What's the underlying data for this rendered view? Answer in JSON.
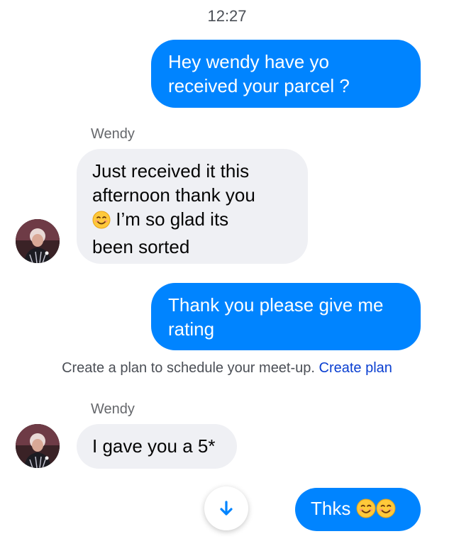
{
  "thread": {
    "timestamp": "12:27",
    "contact_name": "Wendy"
  },
  "messages": [
    {
      "sender": "me",
      "text": "Hey wendy have yo\nreceived your parcel ?"
    },
    {
      "sender": "Wendy",
      "lines": [
        "Just received it this",
        "afternoon thank you",
        "I’m so glad its",
        "been sorted"
      ],
      "emoji": "smiling-face-with-smiling-eyes"
    },
    {
      "sender": "me",
      "text": "Thank you please give me\nrating"
    },
    {
      "sender": "Wendy",
      "text": "I gave you a 5*"
    },
    {
      "sender": "me",
      "text": "Thks",
      "emojis": [
        "smiling-face-with-smiling-eyes",
        "smiling-face-with-smiling-eyes"
      ]
    }
  ],
  "plan_notice": {
    "text": "Create a plan to schedule your meet-up.",
    "link_label": "Create plan",
    "link_color": "#0a3fd1"
  },
  "icons": {
    "scroll_down": "arrow-down-icon",
    "avatar": "contact-avatar"
  },
  "colors": {
    "outgoing_bubble": "#0084ff",
    "incoming_bubble": "#eff0f4",
    "scroll_arrow": "#0084ff"
  }
}
